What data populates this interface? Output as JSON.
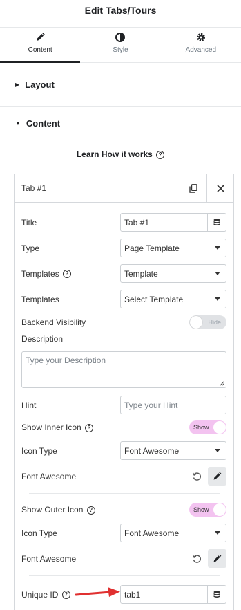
{
  "header": {
    "title": "Edit Tabs/Tours"
  },
  "tabs": [
    {
      "label": "Content",
      "icon": "pencil-icon",
      "active": true
    },
    {
      "label": "Style",
      "icon": "contrast-icon",
      "active": false
    },
    {
      "label": "Advanced",
      "icon": "gear-icon",
      "active": false
    }
  ],
  "sections": {
    "layout": {
      "label": "Layout"
    },
    "content": {
      "label": "Content"
    }
  },
  "learn": {
    "label": "Learn How it works"
  },
  "repeater": {
    "title": "Tab #1",
    "fields": {
      "title": {
        "label": "Title",
        "value": "Tab #1"
      },
      "type": {
        "label": "Type",
        "value": "Page Template"
      },
      "templates1": {
        "label": "Templates",
        "value": "Template"
      },
      "templates2": {
        "label": "Templates",
        "value": "Select Template"
      },
      "backend_visibility": {
        "label": "Backend Visibility",
        "toggle": "Hide"
      },
      "description": {
        "label": "Description",
        "placeholder": "Type your Description"
      },
      "hint": {
        "label": "Hint",
        "placeholder": "Type your Hint"
      },
      "show_inner_icon": {
        "label": "Show Inner Icon",
        "toggle": "Show"
      },
      "icon_type_inner": {
        "label": "Icon Type",
        "value": "Font Awesome"
      },
      "font_awesome_inner": {
        "label": "Font Awesome"
      },
      "show_outer_icon": {
        "label": "Show Outer Icon",
        "toggle": "Show"
      },
      "icon_type_outer": {
        "label": "Icon Type",
        "value": "Font Awesome"
      },
      "font_awesome_outer": {
        "label": "Font Awesome"
      },
      "unique_id": {
        "label": "Unique ID",
        "value": "tab1"
      }
    }
  },
  "colors": {
    "toggle_on": "#f3c3f0",
    "toggle_off": "#e0e2e5",
    "annotation_arrow": "#e03030"
  }
}
